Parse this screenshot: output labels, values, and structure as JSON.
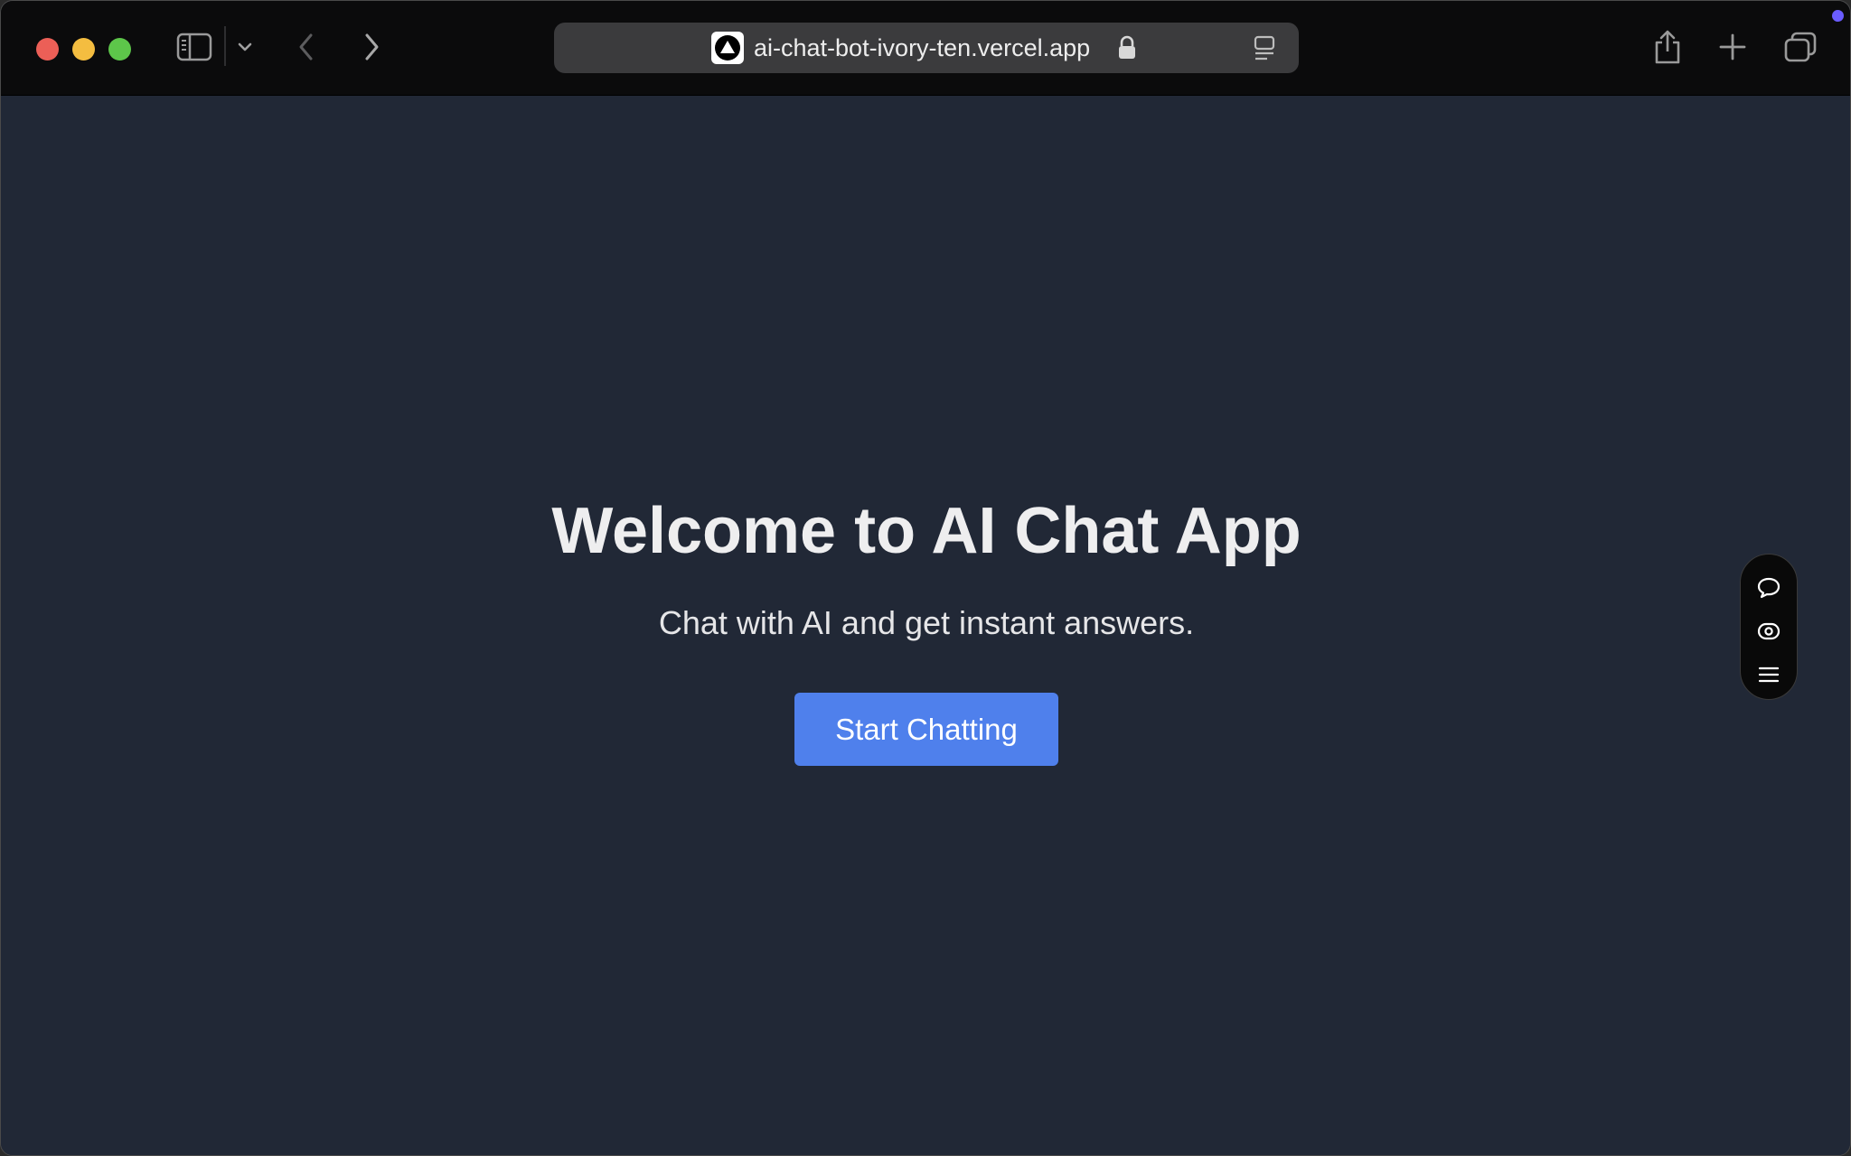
{
  "browser": {
    "url": "ai-chat-bot-ivory-ten.vercel.app",
    "accent_dot_color": "#6a5cff"
  },
  "toolbar_icons": {
    "sidebar": "sidebar-toggle-icon",
    "sidebar_menu": "chevron-down-icon",
    "back": "chevron-left-icon",
    "forward": "chevron-right-icon",
    "lock": "lock-icon",
    "reader": "reader-mode-icon",
    "share": "share-icon",
    "new_tab": "plus-icon",
    "tabs": "tab-overview-icon"
  },
  "hero": {
    "title": "Welcome to AI Chat App",
    "subtitle": "Chat with AI and get instant answers.",
    "cta_label": "Start Chatting",
    "cta_color": "#4f80ec",
    "background_color": "#212836"
  },
  "floating_toolbar": {
    "icons": [
      "chat-bubble-icon",
      "eye-icon",
      "menu-icon"
    ]
  }
}
